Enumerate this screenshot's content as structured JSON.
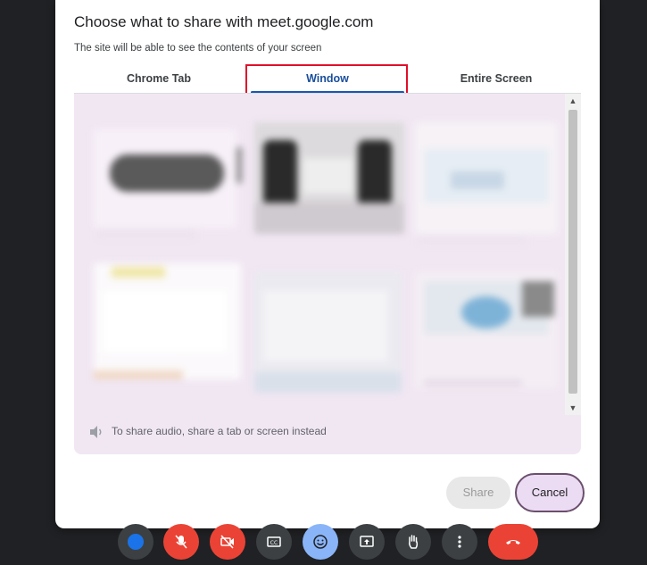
{
  "dialog": {
    "title": "Choose what to share with meet.google.com",
    "subtitle": "The site will be able to see the contents of your screen",
    "tabs": [
      {
        "label": "Chrome Tab",
        "selected": false
      },
      {
        "label": "Window",
        "selected": true
      },
      {
        "label": "Entire Screen",
        "selected": false
      }
    ],
    "audio_note": "To share audio, share a tab or screen instead",
    "share_label": "Share",
    "cancel_label": "Cancel"
  },
  "colors": {
    "accent": "#1a56b4",
    "highlight_box": "#e0102a",
    "panel_bg": "#f1e7f3",
    "cancel_bg": "#ecdcf3",
    "end_call": "#ea4335",
    "meet_bar_bg": "#202124"
  },
  "meet_toolbar": {
    "icons": [
      "avatar-dot",
      "mic-off-icon",
      "camera-off-icon",
      "captions-icon",
      "emoji-icon",
      "present-icon",
      "raise-hand-icon",
      "more-options-icon",
      "end-call-icon"
    ]
  }
}
